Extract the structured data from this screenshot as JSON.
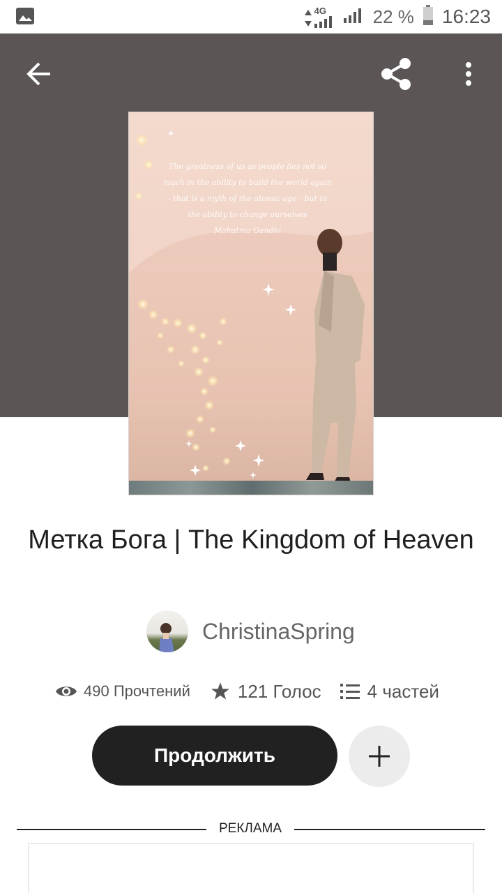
{
  "status_bar": {
    "network": "4G",
    "battery": "22 %",
    "time": "16:23"
  },
  "toolbar": {
    "back_icon": "arrow-left-icon",
    "share_icon": "share-icon",
    "more_icon": "more-vertical-icon"
  },
  "cover": {
    "quote_lines": [
      "The greatness of us as people lies not so",
      "much in the ability to build the world again",
      "- that is a myth of the atomic age - but in",
      "the ability to change ourselves",
      "Mahatma Gandhi"
    ]
  },
  "story": {
    "title": "Метка Бога |  The Kingdom of Heaven",
    "author": "ChristinaSpring"
  },
  "stats": {
    "reads": "490 Прочтений",
    "votes": "121 Голос",
    "parts": "4 частей"
  },
  "actions": {
    "continue_label": "Продолжить",
    "add_icon": "plus-icon"
  },
  "ad": {
    "label": "РЕКЛАМА"
  },
  "colors": {
    "header_bg": "#5b5655",
    "button_dark": "#222122",
    "add_button_bg": "#ececec"
  }
}
